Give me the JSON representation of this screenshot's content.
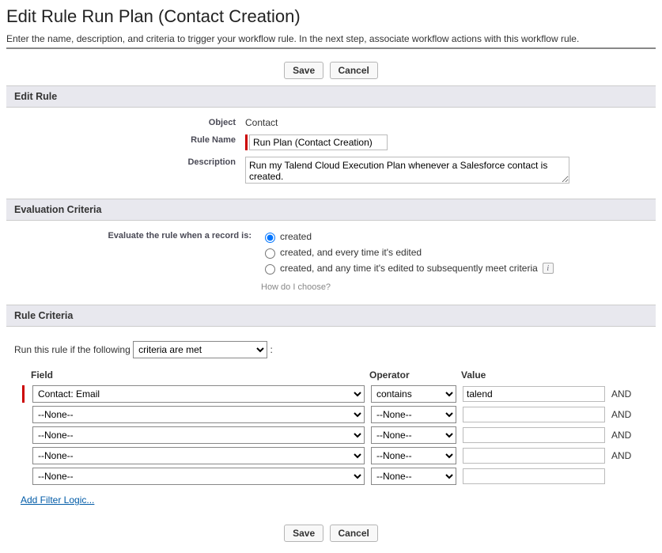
{
  "page": {
    "title": "Edit Rule Run Plan (Contact Creation)",
    "instructions": "Enter the name, description, and criteria to trigger your workflow rule. In the next step, associate workflow actions with this workflow rule."
  },
  "buttons": {
    "save": "Save",
    "cancel": "Cancel"
  },
  "sections": {
    "editRule": {
      "header": "Edit Rule",
      "objectLabel": "Object",
      "objectValue": "Contact",
      "ruleNameLabel": "Rule Name",
      "ruleNameValue": "Run Plan (Contact Creation)",
      "descriptionLabel": "Description",
      "descriptionValue": "Run my Talend Cloud Execution Plan whenever a Salesforce contact is created."
    },
    "evaluation": {
      "header": "Evaluation Criteria",
      "evalLabel": "Evaluate the rule when a record is:",
      "radios": {
        "r1": "created",
        "r2": "created, and every time it's edited",
        "r3": "created, and any time it's edited to subsequently meet criteria"
      },
      "selected": "r1",
      "helpLink": "How do I choose?",
      "infoTooltip": "i"
    },
    "ruleCriteria": {
      "header": "Rule Criteria",
      "runLinePrefix": "Run this rule if the following",
      "runSelectValue": "criteria are met",
      "columns": {
        "field": "Field",
        "operator": "Operator",
        "value": "Value"
      },
      "noneOption": "--None--",
      "rows": [
        {
          "field": "Contact: Email",
          "operator": "contains",
          "value": "talend",
          "conj": "AND"
        },
        {
          "field": "--None--",
          "operator": "--None--",
          "value": "",
          "conj": "AND"
        },
        {
          "field": "--None--",
          "operator": "--None--",
          "value": "",
          "conj": "AND"
        },
        {
          "field": "--None--",
          "operator": "--None--",
          "value": "",
          "conj": "AND"
        },
        {
          "field": "--None--",
          "operator": "--None--",
          "value": "",
          "conj": ""
        }
      ],
      "addFilterLogic": "Add Filter Logic..."
    }
  }
}
